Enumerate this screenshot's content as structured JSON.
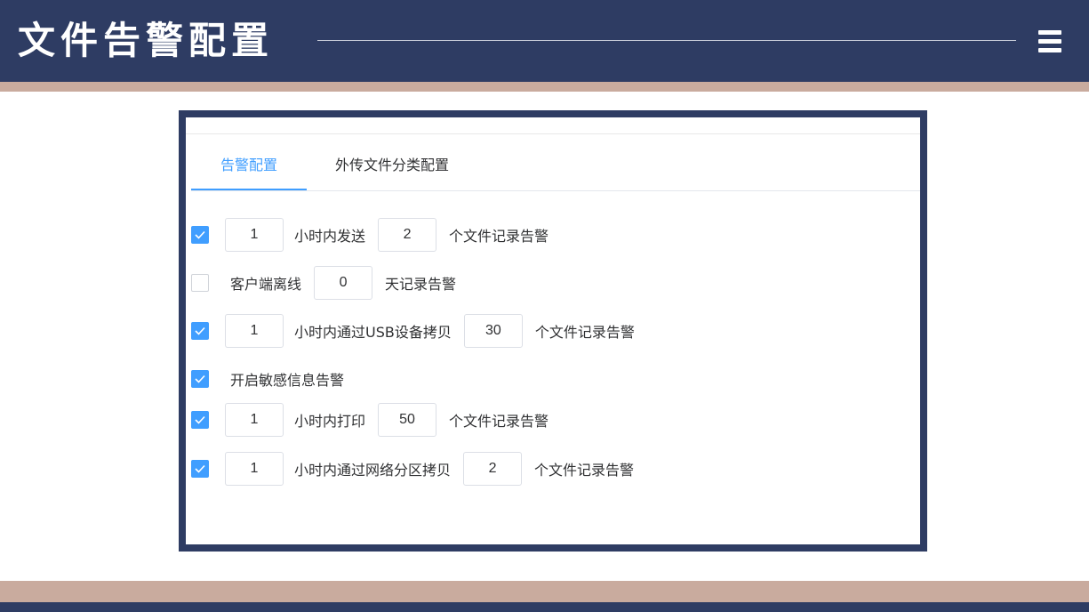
{
  "header": {
    "title": "文件告警配置",
    "menu_icon": "hamburger-menu-icon"
  },
  "colors": {
    "navy": "#2e3c63",
    "accent": "#c9ab9e",
    "primary": "#409eff"
  },
  "tabs": [
    {
      "label": "告警配置",
      "active": true
    },
    {
      "label": "外传文件分类配置",
      "active": false
    }
  ],
  "rows": [
    {
      "checked": true,
      "value1": "1",
      "label1": "小时内发送",
      "value2": "2",
      "label2": "个文件记录告警"
    },
    {
      "checked": false,
      "label0": "客户端离线",
      "value1": "0",
      "label1": "天记录告警"
    },
    {
      "checked": true,
      "value1": "1",
      "label1": "小时内通过USB设备拷贝",
      "value2": "30",
      "label2": "个文件记录告警"
    },
    {
      "checked": true,
      "label0": "开启敏感信息告警"
    },
    {
      "checked": true,
      "value1": "1",
      "label1": "小时内打印",
      "value2": "50",
      "label2": "个文件记录告警"
    },
    {
      "checked": true,
      "value1": "1",
      "label1": "小时内通过网络分区拷贝",
      "value2": "2",
      "label2": "个文件记录告警"
    }
  ]
}
